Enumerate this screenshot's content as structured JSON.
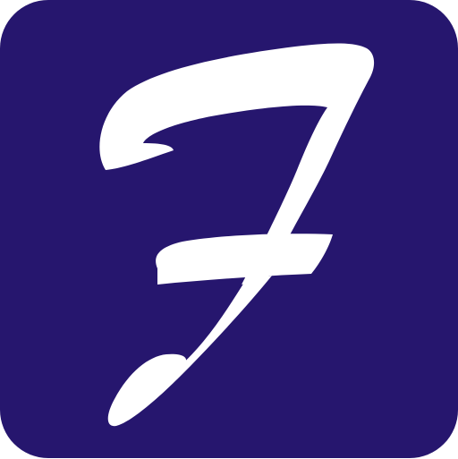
{
  "icon": {
    "name": "F",
    "letter": "F",
    "colors": {
      "background": "#26166e",
      "glyph": "#ffffff",
      "page": "#ffffff"
    }
  }
}
